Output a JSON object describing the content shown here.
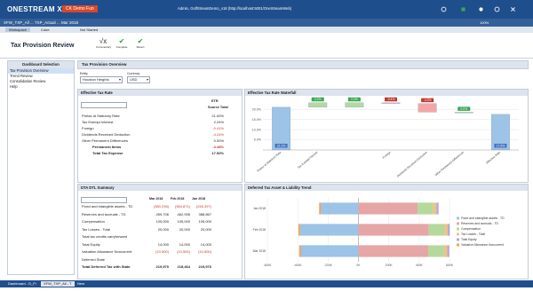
{
  "app": {
    "brand": "ONESTREAM XF",
    "ribbon": "CK Demo Fun",
    "admin_text": "Admin, GolfStreamDemo_v18 (http://localhost:5001/OneStreamWeb)"
  },
  "tabs": {
    "workflow_path": "XFW_TXP_All ... TXP_Actual ... Mar 2018",
    "sub_tabs": [
      "Workspace",
      "Cube",
      "Not Started"
    ]
  },
  "page": {
    "title": "Tax Provision Review",
    "actions": [
      "Commentary",
      "Complete",
      "Revert"
    ]
  },
  "sidebar": {
    "header": "Dashboard Selection",
    "items": [
      {
        "label": "Tax Provision Overview"
      },
      {
        "label": "Trend Review"
      },
      {
        "label": "Consolidation Review"
      },
      {
        "label": "Help"
      }
    ]
  },
  "main": {
    "header": "Tax Provision Overview",
    "entity_label": "Entity",
    "entity_value": "Houston Heights",
    "currency_label": "Currency",
    "currency_value": "USD"
  },
  "etr": {
    "title": "Effective Tax Rate",
    "col1": "ETR",
    "col2": "Source Total",
    "rows": [
      {
        "label": "Pretax at Statutory Rate",
        "value": "21.00%"
      },
      {
        "label": "Tax Exempt Interest",
        "value": "2.24%"
      },
      {
        "label": "Foreign",
        "value": "-0.41%"
      },
      {
        "label": "Dividends Received Deduction",
        "value": "-4.24%"
      },
      {
        "label": "Other Permanent Differences",
        "value": "0.00%"
      },
      {
        "label": "Permanent Items",
        "value": "-3.48%"
      },
      {
        "label": "Total Tax Expense",
        "value": "17.52%"
      }
    ]
  },
  "dta": {
    "title": "DTA DTL Summary",
    "cols": [
      "Mar 2018",
      "Feb 2018",
      "Jan 2018"
    ],
    "rows": [
      {
        "label": "Fixed and intangible assets - TD",
        "v": [
          "(380,236)",
          "(384,871)",
          "(248,397)"
        ]
      },
      {
        "label": "Reserves and accruals - TD",
        "v": [
          "459,706",
          "462,935",
          "388,867"
        ]
      },
      {
        "label": "Compensation",
        "v": [
          "105,000",
          "105,000",
          "105,000"
        ]
      },
      {
        "label": "Tax Losses - Total",
        "v": [
          "20,000",
          "20,000",
          "20,000"
        ]
      },
      {
        "label": "Total tax credits carryforward",
        "v": [
          "",
          "",
          ""
        ]
      },
      {
        "label": "Total Equity",
        "v": [
          "14,000",
          "14,000",
          "14,000"
        ]
      },
      {
        "label": "Valuation Allowance Noncurrent",
        "v": [
          "(10,500)",
          "(10,500)",
          "(10,500)"
        ]
      },
      {
        "label": "Deferred State",
        "v": [
          "",
          "",
          ""
        ]
      },
      {
        "label": "Total Deferred Tax with State",
        "v": [
          "219,970",
          "218,464",
          "219,970"
        ]
      }
    ]
  },
  "waterfall": {
    "title": "Effective Tax Rate Waterfall",
    "yticks": [
      "20.0%",
      "15.0%",
      "10.0%",
      "5.0%"
    ],
    "bar_labels": [
      "21.0%",
      "2.2%",
      "2.2%",
      "-0.4%",
      "-4.2%",
      "0.0%",
      "17.5%"
    ],
    "categories": [
      "Pretax at Statutory Rate",
      "Tax Exempt Interest",
      "Foreign",
      "Dividends Received Deduction",
      "Other Permanent Differences",
      "Effective Rate"
    ]
  },
  "trend": {
    "title": "Deferred Tax Asset & Liability Trend",
    "rows": [
      "Jan 2018",
      "Feb 2018",
      "Mar 2018"
    ],
    "xticks": [
      "-600K",
      "-400K",
      "-200K",
      "0K",
      "200K",
      "400K",
      "600K"
    ],
    "legend": [
      {
        "label": "Fixed and intangible assets - TD",
        "color": "#9dc3e6"
      },
      {
        "label": "Reserves and accruals - TD",
        "color": "#e6a6a6"
      },
      {
        "label": "Compensation",
        "color": "#b5d99c"
      },
      {
        "label": "Tax Losses - Total",
        "color": "#f4c084"
      },
      {
        "label": "Total Equity",
        "color": "#b4a7d6"
      },
      {
        "label": "Valuation Allowance Noncurrent",
        "color": "#f6a04d"
      }
    ]
  },
  "taskbar": {
    "items": [
      "Dashboard - D_Fi",
      "XFW_TXP_All - T",
      "New"
    ]
  }
}
